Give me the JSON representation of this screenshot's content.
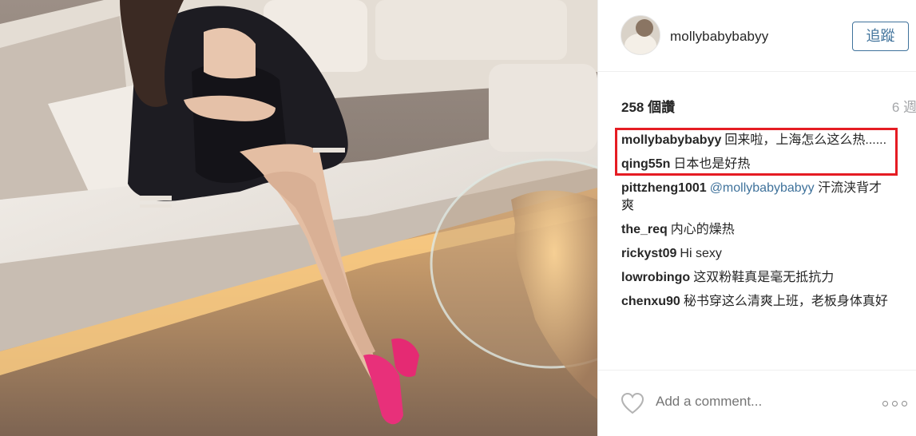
{
  "post": {
    "username": "mollybabybabyy",
    "follow_label": "追蹤",
    "views": "258 個讚",
    "time_ago": "6 週"
  },
  "comments": [
    {
      "user": "mollybabybabyy",
      "text": "回来啦，上海怎么这么热......"
    },
    {
      "user": "qing55n",
      "text": "日本也是好热"
    },
    {
      "user": "pittzheng1001",
      "mention": "@mollybabybabyy",
      "text": "汗流浃背才爽"
    },
    {
      "user": "the_req",
      "text": "内心的燥热"
    },
    {
      "user": "rickyst09",
      "text": "Hi sexy"
    },
    {
      "user": "lowrobingo",
      "text": "这双粉鞋真是毫无抵抗力"
    },
    {
      "user": "chenxu90",
      "text": "秘书穿这么清爽上班，老板身体真好"
    }
  ],
  "footer": {
    "add_comment_placeholder": "Add a comment...",
    "icons": [
      "heart-icon",
      "more-options-icon"
    ]
  },
  "colors": {
    "follow_blue": "#3f729b",
    "highlight_red": "#e51c23",
    "muted_gray": "#a5a7aa",
    "shoe_pink": "#e8307a"
  }
}
